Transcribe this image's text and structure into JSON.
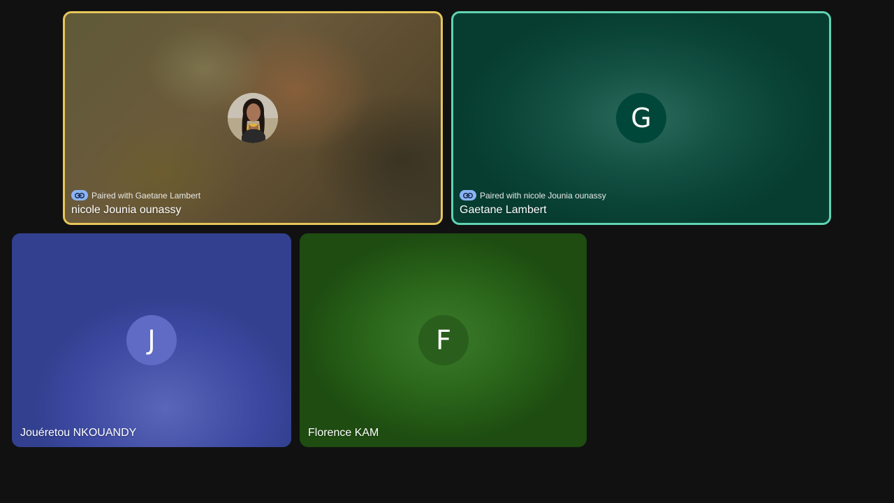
{
  "tiles": [
    {
      "name": "nicole Jounia ounassy",
      "paired_text": "Paired with Gaetane Lambert",
      "border_color": "#e6c65a",
      "avatar": "profile-photo"
    },
    {
      "name": "Gaetane Lambert",
      "paired_text": "Paired with nicole Jounia ounassy",
      "border_color": "#5fd4b3",
      "avatar_letter": "G"
    },
    {
      "name": "Jouéretou NKOUANDY",
      "avatar_letter": "J"
    },
    {
      "name": "Florence KAM",
      "avatar_letter": "F"
    }
  ],
  "icons": {
    "paired": "link-icon"
  },
  "colors": {
    "background": "#111111",
    "link_badge": "#8ab4f8"
  }
}
